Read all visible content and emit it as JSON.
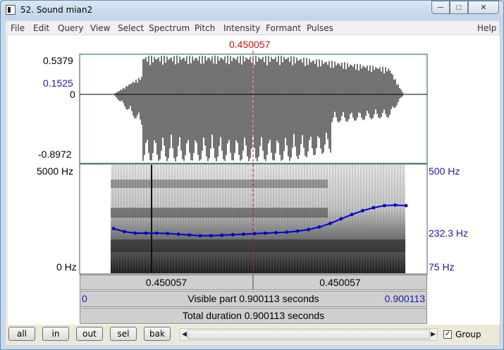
{
  "window": {
    "title": "52. Sound mian2",
    "minimize_icon": "minimize-icon",
    "maximize_icon": "maximize-icon",
    "close_icon": "close-icon"
  },
  "menu": [
    "File",
    "Edit",
    "Query",
    "View",
    "Select",
    "Spectrum",
    "Pitch",
    "Intensity",
    "Formant",
    "Pulses"
  ],
  "menu_help": "Help",
  "cursor_time": "0.450057",
  "waveform": {
    "y_max": "0.5379",
    "y_cursor_value": "0.1525",
    "y_zero": "0",
    "y_min": "-0.8972"
  },
  "spectrogram": {
    "freq_max": "5000 Hz",
    "freq_min": "0 Hz"
  },
  "pitch": {
    "top": "500 Hz",
    "value": "232.3 Hz",
    "bottom": "75 Hz",
    "color": "#0000cc",
    "values_hz": [
      250,
      238,
      232,
      232,
      232,
      231,
      228,
      225,
      222,
      222,
      224,
      226,
      228,
      230,
      232,
      234,
      236,
      240,
      246,
      256,
      270,
      288,
      305,
      320,
      332,
      340,
      342,
      340
    ]
  },
  "time_bar": {
    "left": "0.450057",
    "right": "0.450057"
  },
  "visible_bar": {
    "start": "0",
    "label": "Visible part 0.900113 seconds",
    "end": "0.900113"
  },
  "total_bar": {
    "label": "Total duration 0.900113 seconds"
  },
  "buttons": {
    "all": "all",
    "in": "in",
    "out": "out",
    "sel": "sel",
    "bak": "bak"
  },
  "group": {
    "label": "Group",
    "checked": true
  }
}
